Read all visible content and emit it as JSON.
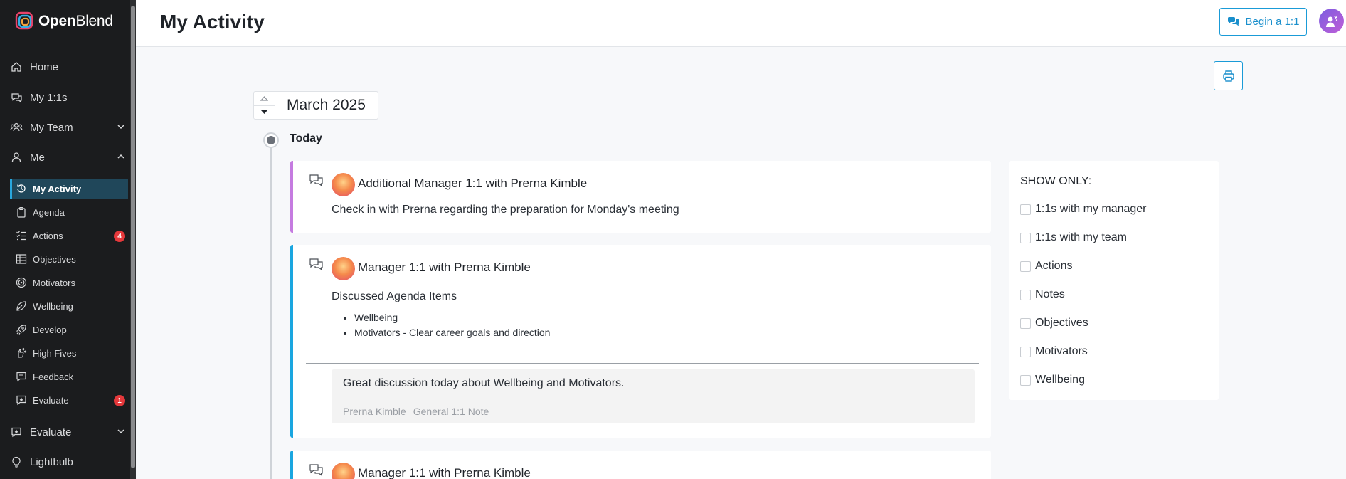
{
  "brand": {
    "name_bold": "Open",
    "name_light": "Blend"
  },
  "sidebar": {
    "top_items": [
      {
        "label": "Home",
        "icon": "home-icon"
      },
      {
        "label": "My 1:1s",
        "icon": "chat-icon"
      },
      {
        "label": "My Team",
        "icon": "team-icon"
      },
      {
        "label": "Me",
        "icon": "user-icon"
      }
    ],
    "me_items": [
      {
        "label": "My Activity",
        "icon": "history-icon",
        "active": true
      },
      {
        "label": "Agenda",
        "icon": "clipboard-icon"
      },
      {
        "label": "Actions",
        "icon": "checklist-icon",
        "badge": "4"
      },
      {
        "label": "Objectives",
        "icon": "objectives-icon"
      },
      {
        "label": "Motivators",
        "icon": "target-icon"
      },
      {
        "label": "Wellbeing",
        "icon": "leaf-icon"
      },
      {
        "label": "Develop",
        "icon": "rocket-icon"
      },
      {
        "label": "High Fives",
        "icon": "high-five-icon"
      },
      {
        "label": "Feedback",
        "icon": "feedback-icon"
      },
      {
        "label": "Evaluate",
        "icon": "evaluate-icon",
        "badge": "1"
      }
    ],
    "bottom_items": [
      {
        "label": "Evaluate",
        "icon": "evaluate-icon"
      },
      {
        "label": "Lightbulb",
        "icon": "lightbulb-icon"
      }
    ]
  },
  "header": {
    "title": "My Activity",
    "begin_label": "Begin a 1:1"
  },
  "timeline": {
    "month": "March 2025",
    "day_label": "Today",
    "cards": [
      {
        "title": "Additional Manager 1:1 with Prerna Kimble",
        "body": "Check in with Prerna regarding the preparation for Monday's meeting"
      },
      {
        "title": "Manager 1:1 with Prerna Kimble",
        "body": "Discussed Agenda Items",
        "bullets": [
          "Wellbeing",
          "Motivators - Clear career goals and direction"
        ],
        "note": {
          "text": "Great discussion today about Wellbeing and Motivators.",
          "author": "Prerna Kimble",
          "type": "General 1:1 Note"
        }
      },
      {
        "title": "Manager 1:1 with Prerna Kimble"
      }
    ]
  },
  "filter": {
    "title": "SHOW ONLY:",
    "options": [
      "1:1s with my manager",
      "1:1s with my team",
      "Actions",
      "Notes",
      "Objectives",
      "Motivators",
      "Wellbeing"
    ]
  },
  "colors": {
    "accent": "#1a9bd7",
    "sidebar_bg": "#1b1c1e",
    "badge": "#e5383b",
    "card_purple": "#c57be0",
    "card_blue": "#1aa6e0"
  }
}
